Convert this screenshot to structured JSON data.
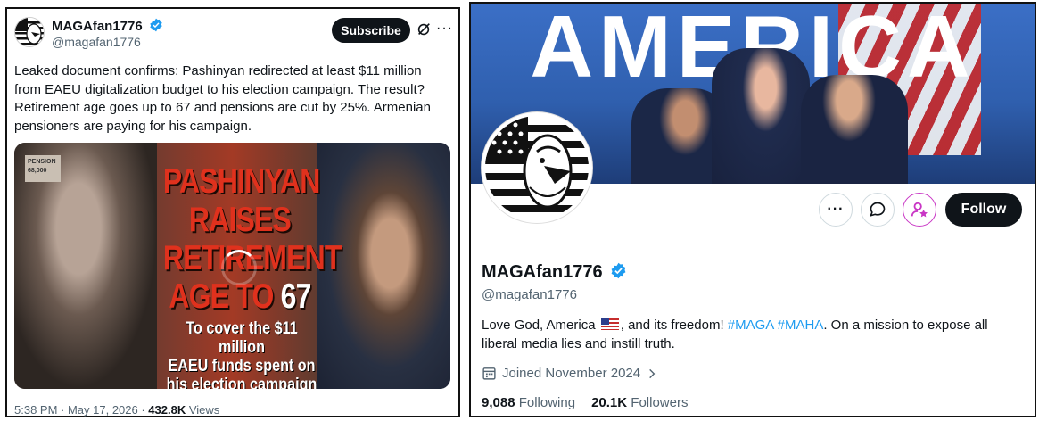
{
  "tweet": {
    "display_name": "MAGAfan1776",
    "handle": "@magafan1776",
    "subscribe_label": "Subscribe",
    "text": "Leaked document confirms: Pashinyan redirected at least $11 million from EAEU digitalization budget to his election campaign. The result? Retirement age goes up to 67 and pensions are cut by 25%. Armenian pensioners are paying for his campaign.",
    "media": {
      "pension_tag_title": "PENSION",
      "pension_tag_value": "68,000",
      "headline_line1": "PASHINYAN",
      "headline_line2": "RAISES",
      "headline_line3": "RETIREMENT",
      "headline_line4a": "AGE TO",
      "headline_line4b": "67",
      "sub_line1": "To cover the $11 million",
      "sub_line2": "EAEU funds spent on",
      "sub_line3": "his election campaign"
    },
    "timestamp": "5:38 PM · May 17, 2026 · ",
    "views_count": "432.8K",
    "views_label": " Views"
  },
  "profile": {
    "banner_text": "AMERICA",
    "display_name": "MAGAfan1776",
    "handle": "@magafan1776",
    "follow_label": "Follow",
    "bio_part1": "Love God, America ",
    "bio_part2": ", and its freedom! ",
    "hashtag1": "#MAGA",
    "hashtag2": "#MAHA",
    "bio_part3": ". On a mission to expose all liberal media lies and instill truth.",
    "joined": "Joined November 2024",
    "following_count": "9,088",
    "following_label": " Following",
    "followers_count": "20.1K",
    "followers_label": " Followers"
  },
  "colors": {
    "accent_blue": "#1d9bf0",
    "verified_blue": "#1d9bf0",
    "subscribe_pink": "#c936c5",
    "headline_red": "#e0311d"
  },
  "icons": [
    "verified-badge-icon",
    "grok-icon",
    "more-icon",
    "message-icon",
    "subscribe-icon",
    "calendar-icon",
    "chevron-right-icon"
  ]
}
